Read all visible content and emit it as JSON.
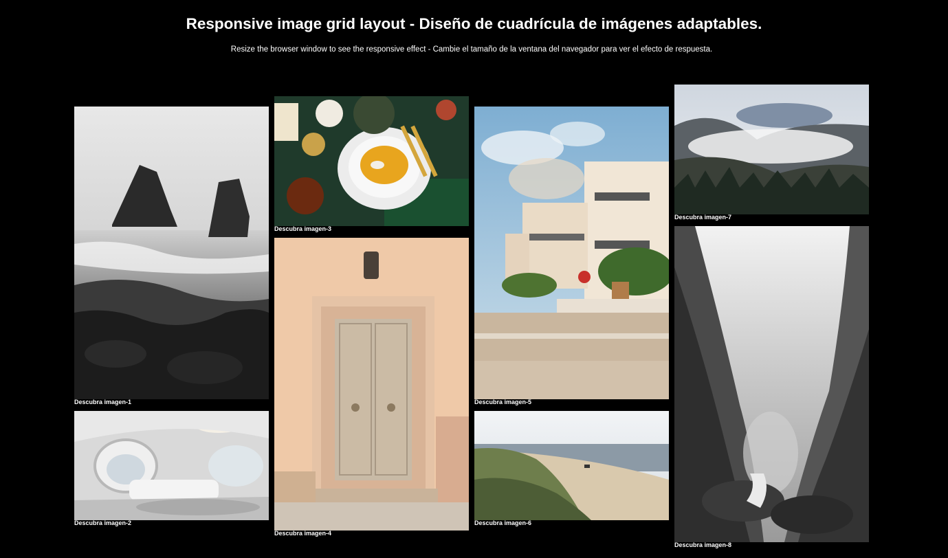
{
  "header": {
    "title": "Responsive image grid layout - Diseño de cuadrícula de imágenes adaptables.",
    "subtitle": "Resize the browser window to see the responsive effect - Cambie el tamaño de la ventana del navegador para ver el efecto de respuesta."
  },
  "gallery": {
    "images": [
      {
        "caption": "Descubra imagen-1"
      },
      {
        "caption": "Descubra imagen-2"
      },
      {
        "caption": "Descubra imagen-3"
      },
      {
        "caption": "Descubra imagen-4"
      },
      {
        "caption": "Descubra imagen-5"
      },
      {
        "caption": "Descubra imagen-6"
      },
      {
        "caption": "Descubra imagen-7"
      },
      {
        "caption": "Descubra imagen-8"
      }
    ]
  }
}
